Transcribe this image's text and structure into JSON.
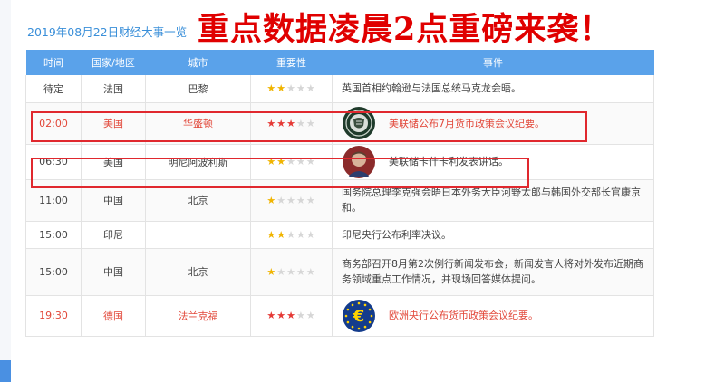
{
  "subtitle": "2019年08月22日财经大事一览",
  "headline": "重点数据凌晨2点重磅来袭！",
  "columns": [
    "时间",
    "国家/地区",
    "城市",
    "重要性",
    "事件"
  ],
  "rows": [
    {
      "time": "待定",
      "country": "法国",
      "city": "巴黎",
      "importance": 2,
      "event": "英国首相约翰逊与法国总统马克龙会晤。",
      "icon": "",
      "highlight": false
    },
    {
      "time": "02:00",
      "country": "美国",
      "city": "华盛顿",
      "importance": 3,
      "event": "美联储公布7月货币政策会议纪要。",
      "icon": "fed-seal-icon",
      "highlight": true
    },
    {
      "time": "06:30",
      "country": "美国",
      "city": "明尼阿波利斯",
      "importance": 2,
      "event": "美联储卡什卡利发表讲话。",
      "icon": "speaker-portrait-icon",
      "highlight": false
    },
    {
      "time": "11:00",
      "country": "中国",
      "city": "北京",
      "importance": 1,
      "event": "国务院总理李克强会晤日本外务大臣河野太郎与韩国外交部长官康京和。",
      "icon": "",
      "highlight": false
    },
    {
      "time": "15:00",
      "country": "印尼",
      "city": "",
      "importance": 2,
      "event": "印尼央行公布利率决议。",
      "icon": "",
      "highlight": false
    },
    {
      "time": "15:00",
      "country": "中国",
      "city": "北京",
      "importance": 1,
      "event": "商务部召开8月第2次例行新闻发布会，新闻发言人将对外发布近期商务领域重点工作情况，并现场回答媒体提问。",
      "icon": "",
      "highlight": false
    },
    {
      "time": "19:30",
      "country": "德国",
      "city": "法兰克福",
      "importance": 3,
      "event": "欧洲央行公布货币政策会议纪要。",
      "icon": "euro-symbol-icon",
      "highlight": true
    }
  ],
  "colors": {
    "header_bg": "#5aa2ea",
    "highlight_text": "#e2483a",
    "headline_red": "#e00000",
    "star_yellow": "#f0b400",
    "star_red": "#e53935",
    "frame_red": "#e0282e"
  }
}
